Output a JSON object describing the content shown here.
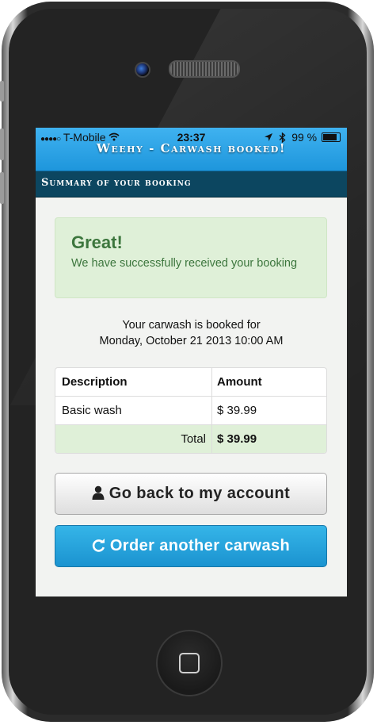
{
  "status_bar": {
    "signal": "●●●●○",
    "carrier": "T-Mobile",
    "wifi_icon": "wifi-icon",
    "time": "23:37",
    "location_icon": "location-arrow-icon",
    "bluetooth_icon": "bluetooth-icon",
    "battery": "99 %"
  },
  "app": {
    "title": "Weehy - Carwash booked!"
  },
  "section": {
    "title": "Summary of your booking"
  },
  "alert": {
    "title": "Great!",
    "message": "We have successfully received your booking"
  },
  "booking": {
    "line1": "Your carwash is booked for",
    "line2": "Monday, October 21 2013 10:00 AM"
  },
  "table": {
    "headers": [
      "Description",
      "Amount"
    ],
    "rows": [
      {
        "description": "Basic wash",
        "amount": "$ 39.99"
      }
    ],
    "total_label": "Total",
    "total_amount": "$ 39.99"
  },
  "buttons": {
    "account_label": "Go back to my account",
    "account_icon": "user-icon",
    "order_label": "Order another carwash",
    "order_icon": "refresh-icon"
  },
  "colors": {
    "header_blue": "#1e96dc",
    "section_bar": "#0c4660",
    "success_bg": "#dff0d8",
    "success_text": "#3c763d"
  }
}
